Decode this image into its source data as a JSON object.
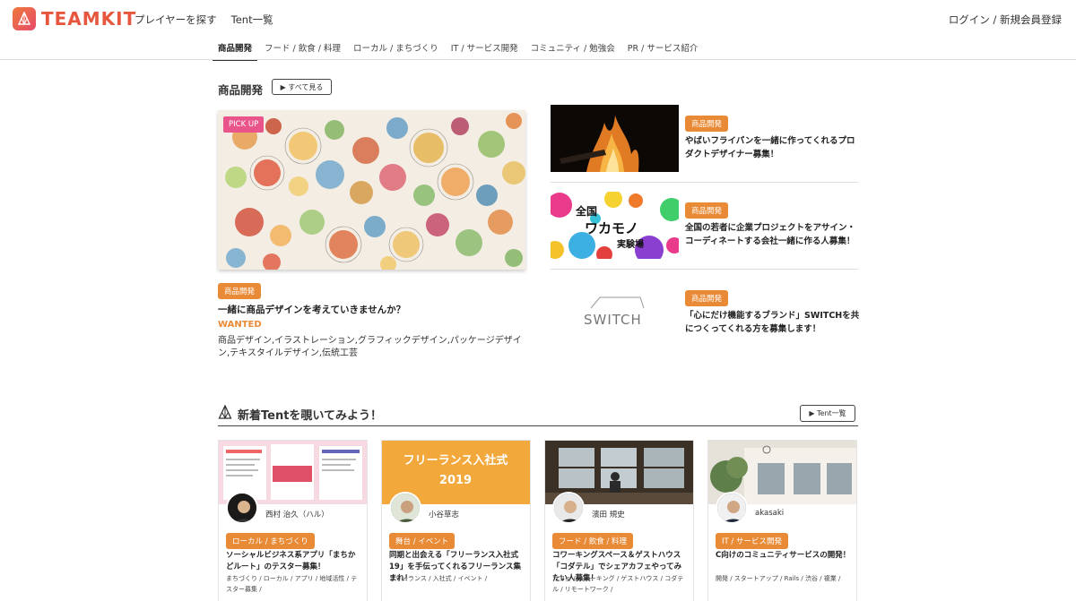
{
  "header": {
    "logo_text": "TEAMKIT",
    "nav": [
      "プレイヤーを探す",
      "Tent一覧"
    ],
    "login": "ログイン / 新規会員登録"
  },
  "category_tabs": [
    "商品開発",
    "フード / 飲食 / 料理",
    "ローカル / まちづくり",
    "IT / サービス開発",
    "コミュニティ / 勉強会",
    "PR / サービス紹介"
  ],
  "section": {
    "title": "商品開発",
    "see_all": "▶ すべて見る"
  },
  "pickup": {
    "badge": "PICK UP",
    "tag": "商品開発",
    "title": "一緒に商品デザインを考えていきませんか？",
    "wanted": "WANTED",
    "skills": "商品デザイン,イラストレーション,グラフィックデザイン,パッケージデザイン,テキスタイルデザイン,伝統工芸"
  },
  "projects": [
    {
      "tag": "商品開発",
      "title": "やばいフライパンを一緒に作ってくれるプロダクトデザイナー募集！"
    },
    {
      "tag": "商品開発",
      "title": "全国の若者に企業プロジェクトをアサイン・コーディネートする会社一緒に作る人募集！",
      "thumb_text_1": "全国",
      "thumb_text_2": "ワカモノ",
      "thumb_text_3": "実験場"
    },
    {
      "tag": "商品開発",
      "title": "「心にだけ機能するブランド」SWITCHを共につくってくれる方を募集します！",
      "thumb_text": "SWITCH"
    }
  ],
  "tent": {
    "title": "新着Tentを覗いてみよう！",
    "button": "▶ Tent一覧"
  },
  "cards": [
    {
      "name": "西村 治久（ハル）",
      "tag": "ローカル / まちづくり",
      "title": "ソーシャルビジネス系アプリ「まちかどルート」のテスター募集！",
      "tags": "まちづくり / ローカル / アプリ / 地域活性 / テスター募集 /"
    },
    {
      "name": "小谷草志",
      "tag": "舞台 / イベント",
      "title": "同期と出会える「フリーランス入社式19」を手伝ってくれるフリーランス集まれ！",
      "tags": "フリーランス / 入社式 / イベント /",
      "banner_1": "フリーランス入社式",
      "banner_2": "2019"
    },
    {
      "name": "濱田 規史",
      "tag": "フード / 飲食 / 料理",
      "title": "コワーキングスペース＆ゲストハウス「コダテル」でシェアカフェやってみたい人募集！",
      "tags": "カフェ / コワーキング / ゲストハウス / コダテル / リモートワーク /"
    },
    {
      "name": "akasaki",
      "tag": "IT / サービス開発",
      "title": "C向けのコミュニティサービスの開発！",
      "tags": "開発 / スタートアップ / Rails / 渋谷 / 複業 /"
    }
  ],
  "colors": {
    "accent": "#e98a36",
    "pickup_badge": "#e9558a",
    "logo": "#e7563f"
  }
}
